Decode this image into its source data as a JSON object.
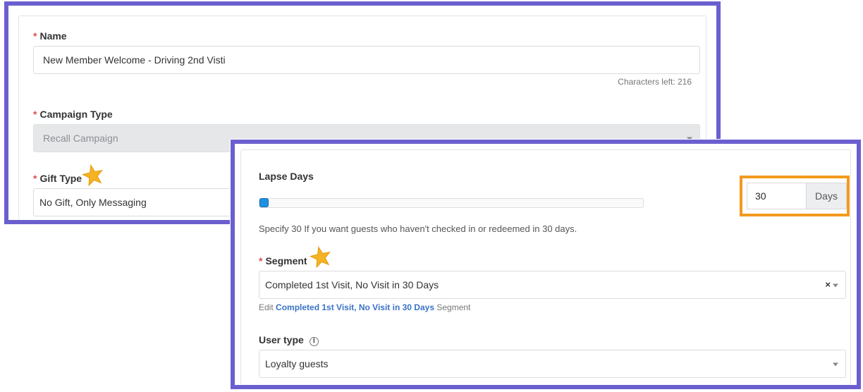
{
  "campaign_form": {
    "name": {
      "label": "Name",
      "value": "New Member Welcome - Driving 2nd Visti",
      "characters_left": "Characters left: 216"
    },
    "campaign_type": {
      "label": "Campaign Type",
      "value": "Recall Campaign"
    },
    "gift_type": {
      "label": "Gift Type",
      "value": "No Gift, Only Messaging"
    }
  },
  "recall_settings": {
    "lapse_days": {
      "label": "Lapse Days",
      "value": "30",
      "unit": "Days",
      "slider_fraction": 0.0,
      "help": "Specify 30 If you want guests who haven't checked in or redeemed in 30 days."
    },
    "segment": {
      "label": "Segment",
      "value": "Completed 1st Visit, No Visit in 30 Days",
      "clear": "×",
      "edit_prefix": "Edit",
      "edit_link": "Completed 1st Visit, No Visit in 30 Days",
      "edit_suffix": "Segment"
    },
    "user_type": {
      "label": "User type",
      "info_icon": "info-icon",
      "value": "Loyalty guests"
    }
  },
  "colors": {
    "panel_border": "#6b5fcf",
    "highlight_border": "#f39a1e",
    "star": "#f5b324",
    "required": "#d9534f",
    "link": "#3a73c6",
    "slider": "#1e90e0"
  }
}
